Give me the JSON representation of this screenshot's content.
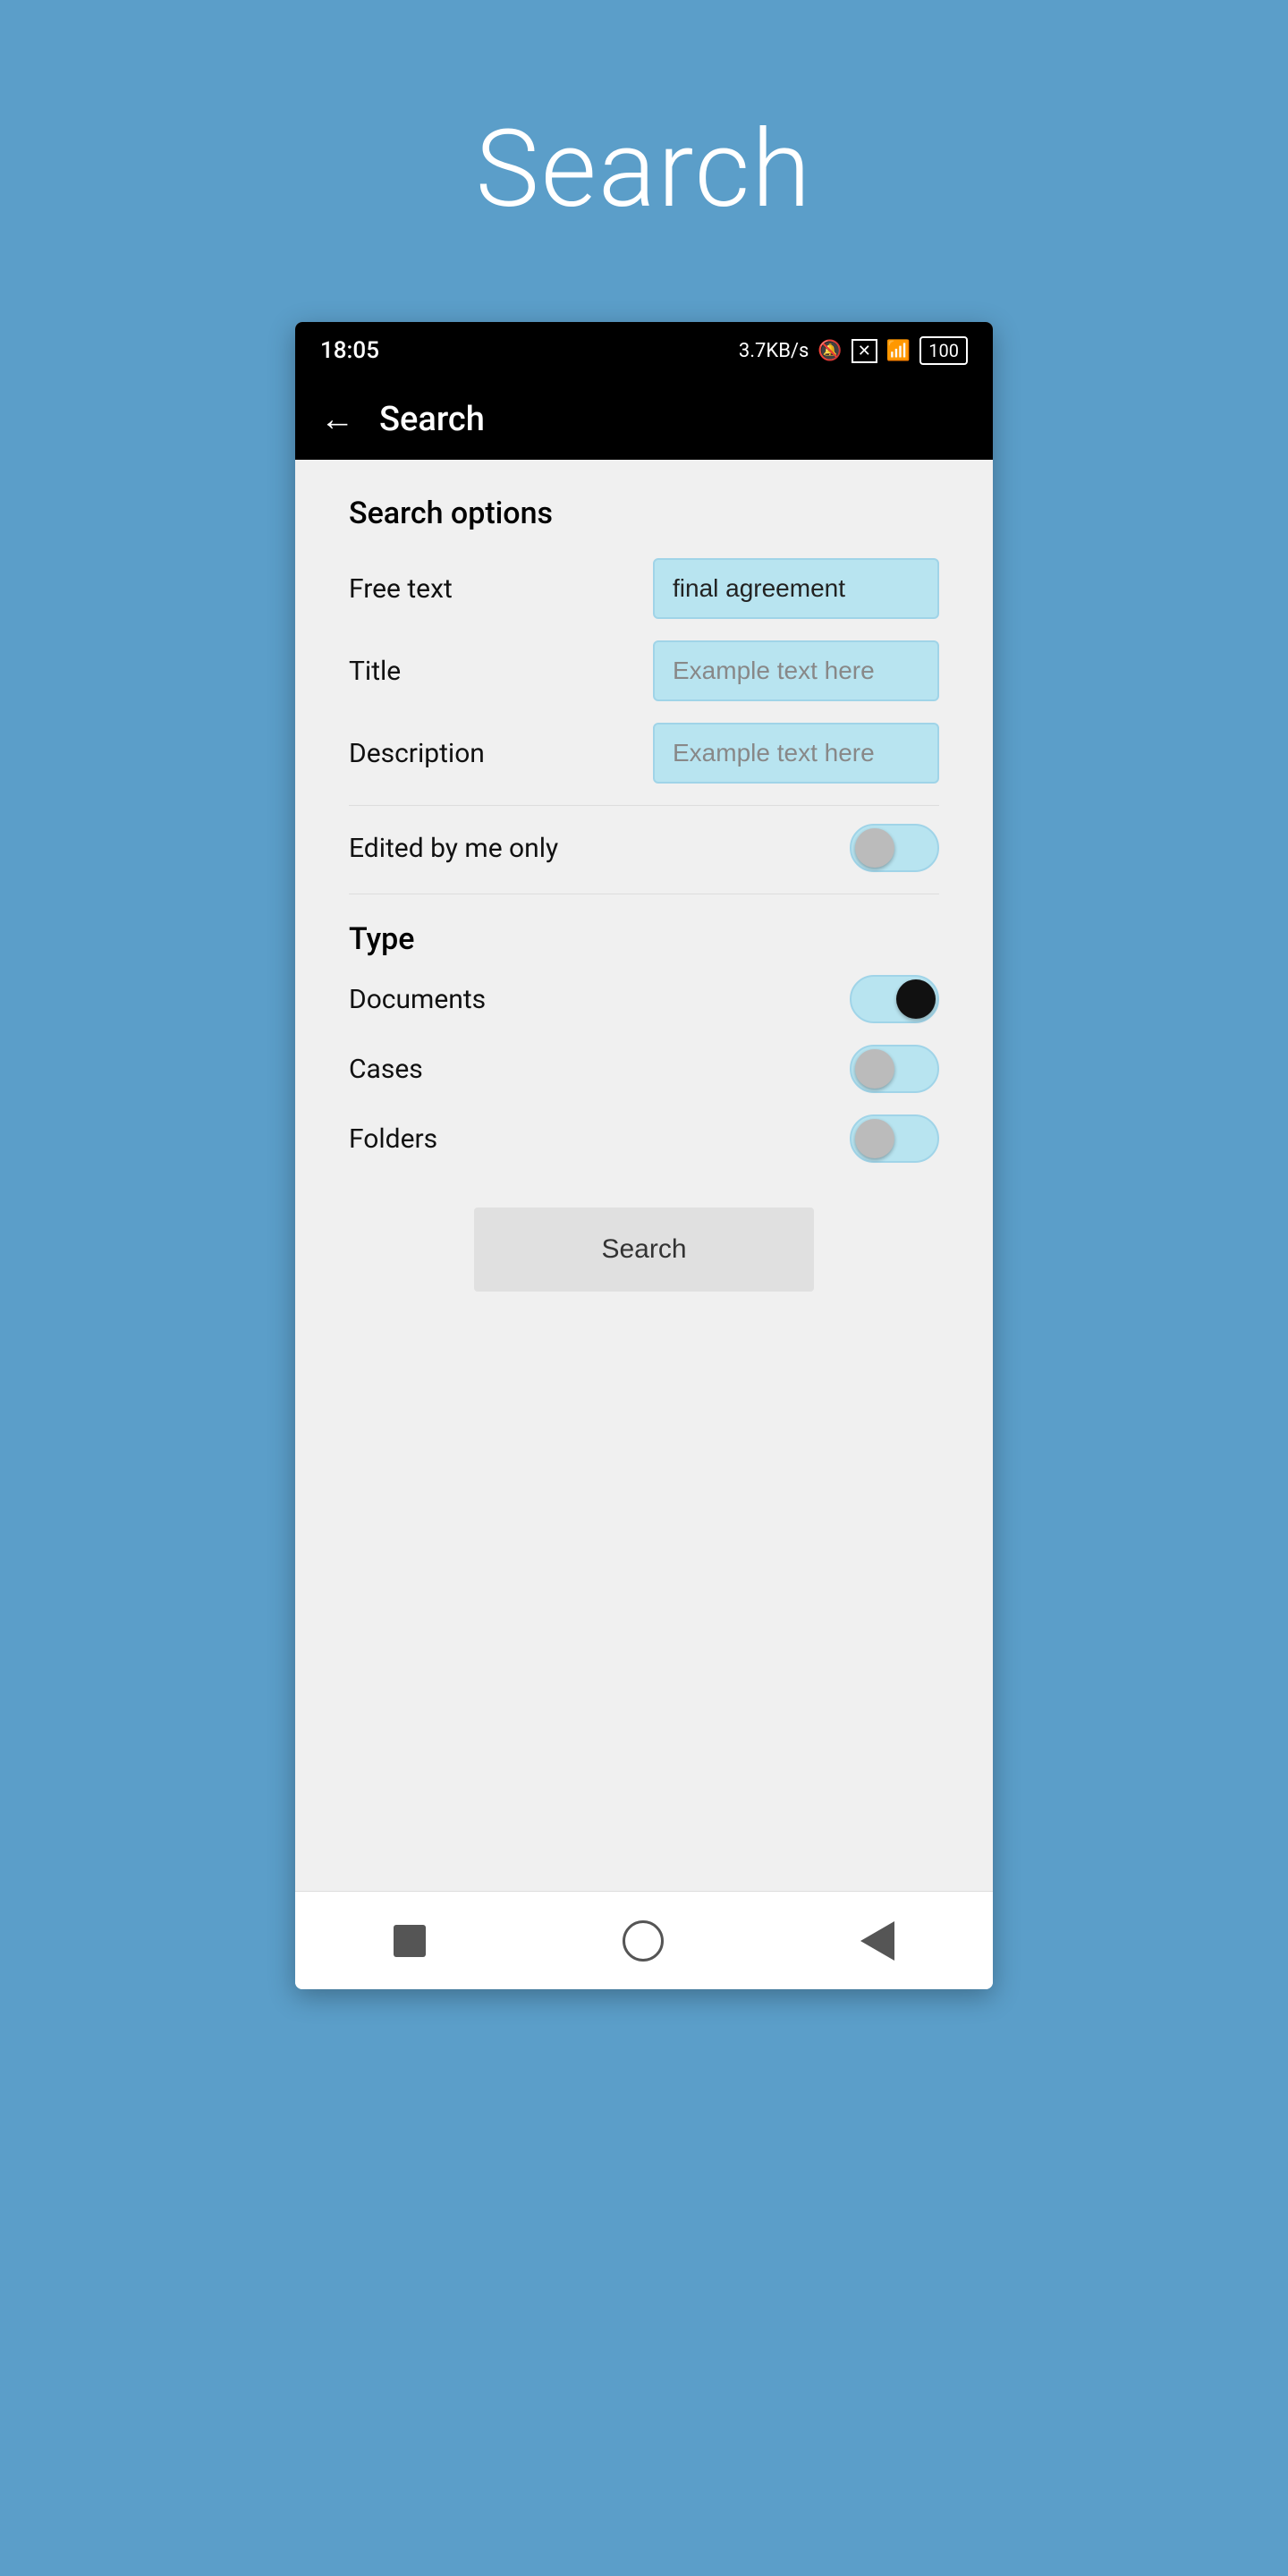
{
  "page": {
    "background_title": "Search",
    "background_color": "#5b9ec9"
  },
  "status_bar": {
    "time": "18:05",
    "speed": "3.7KB/s",
    "battery": "100"
  },
  "app_bar": {
    "title": "Search",
    "back_label": "←"
  },
  "search_options": {
    "section_label": "Search options",
    "free_text_label": "Free text",
    "free_text_value": "final agreement",
    "title_label": "Title",
    "title_placeholder": "Example text here",
    "description_label": "Description",
    "description_placeholder": "Example text here",
    "edited_by_me_label": "Edited by me only",
    "edited_by_me_on": false
  },
  "type_section": {
    "label": "Type",
    "documents_label": "Documents",
    "documents_on": true,
    "cases_label": "Cases",
    "cases_on": false,
    "folders_label": "Folders",
    "folders_on": false
  },
  "search_button": {
    "label": "Search"
  },
  "nav": {
    "square_label": "□",
    "circle_label": "○",
    "back_label": "◁"
  }
}
